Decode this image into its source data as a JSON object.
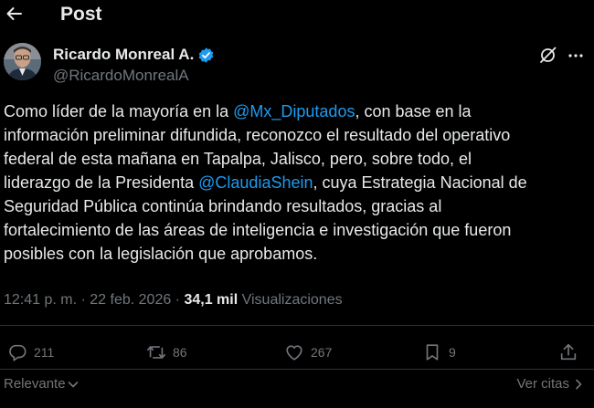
{
  "header": {
    "back_icon": "arrow-left-icon",
    "title": "Post"
  },
  "author": {
    "name": "Ricardo Monreal A.",
    "handle": "@RicardoMonrealA",
    "verified_color": "#1d9bf0"
  },
  "tweet": {
    "segments": {
      "l1a": "Como líder de la mayoría en la ",
      "l1m": "@Mx_Diputados",
      "l1b": ", con base en la",
      "l2": "información preliminar difundida, reconozco el resultado del operativo",
      "l3": "federal de esta mañana en Tapalpa, Jalisco, pero, sobre todo, el",
      "l4a": "liderazgo de la Presidenta ",
      "l4m": "@ClaudiaShein",
      "l4b": ", cuya Estrategia Nacional de",
      "l5": "Seguridad Pública continúa brindando resultados, gracias al",
      "l6": "fortalecimiento de las áreas de inteligencia e investigación que fueron",
      "l7": "posibles con la legislación que aprobamos."
    },
    "mention_color": "#1d9bf0"
  },
  "meta": {
    "time": "12:41 p. m.",
    "separator1": " · ",
    "date": "22 feb. 2026",
    "separator2": " · ",
    "views_count": "34,1 mil",
    "views_label": " Visualizaciones"
  },
  "actions": {
    "replies": "211",
    "reposts": "86",
    "likes": "267",
    "bookmarks": "9"
  },
  "footer": {
    "sort_label": "Relevante",
    "quotes_label": "Ver citas"
  },
  "colors": {
    "background": "#000000",
    "text": "#e7e9ea",
    "muted": "#71767b",
    "divider": "#2f3336",
    "accent": "#1d9bf0"
  }
}
